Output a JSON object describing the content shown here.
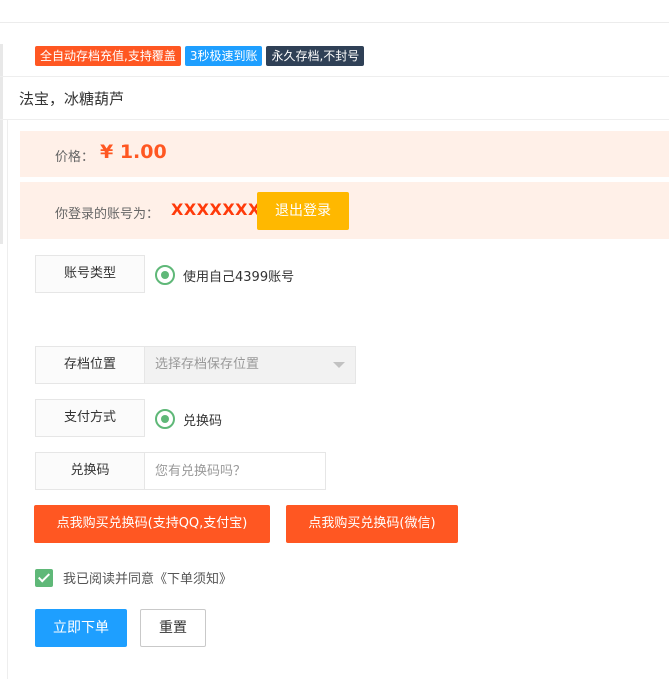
{
  "tags": [
    {
      "label": "全自动存档充值,支持覆盖",
      "color": "#ff5722"
    },
    {
      "label": "3秒极速到账",
      "color": "#1e9fff"
    },
    {
      "label": "永久存档,不封号",
      "color": "#2f4056"
    }
  ],
  "product": {
    "name": "法宝，冰糖葫芦"
  },
  "price": {
    "label": "价格：",
    "value": "¥ 1.00",
    "color": "#ff5722"
  },
  "account": {
    "label": "你登录的账号为：",
    "value": "XXXXXXX",
    "logout_label": "退出登录"
  },
  "form": {
    "account_type": {
      "label": "账号类型",
      "option": "使用自己4399账号"
    },
    "save_location": {
      "label": "存档位置",
      "placeholder": "选择存档保存位置"
    },
    "payment": {
      "label": "支付方式",
      "option": "兑换码"
    },
    "redeem_code": {
      "label": "兑换码",
      "placeholder": "您有兑换码吗？"
    }
  },
  "buy_buttons": {
    "qq_alipay": "点我购买兑换码(支持QQ,支付宝)",
    "wechat": "点我购买兑换码(微信)"
  },
  "agreement": {
    "text": "我已阅读并同意《下单须知》",
    "checked": true
  },
  "actions": {
    "submit": "立即下单",
    "reset": "重置"
  },
  "colors": {
    "accent_orange": "#ff5722",
    "accent_blue": "#1e9fff",
    "accent_yellow": "#ffb800",
    "success_green": "#5fb878",
    "band_bg": "#fff0e8"
  }
}
